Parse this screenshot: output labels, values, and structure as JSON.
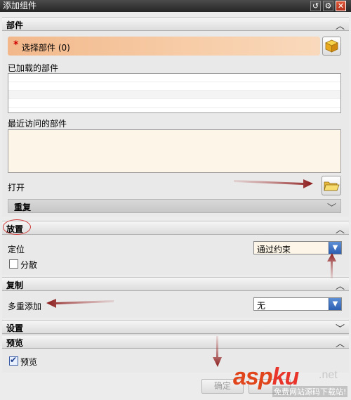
{
  "window": {
    "title": "添加组件",
    "reset_icon": "reset-icon",
    "settings_icon": "gear-icon",
    "close_icon": "close-icon"
  },
  "sections": {
    "part": {
      "header": "部件",
      "select_part": "选择部件 (0)",
      "required_mark": "*",
      "loaded_label": "已加载的部件",
      "recent_label": "最近访问的部件",
      "open_label": "打开",
      "repeat_header": "重复"
    },
    "placement": {
      "header": "放置",
      "position_label": "定位",
      "position_value": "通过约束",
      "scatter_label": "分散",
      "scatter_checked": false
    },
    "copy": {
      "header": "复制",
      "multi_add_label": "多重添加",
      "multi_add_value": "无"
    },
    "settings": {
      "header": "设置"
    },
    "preview": {
      "header": "预览",
      "preview_label": "预览",
      "preview_checked": true
    }
  },
  "footer": {
    "ok_label": "确定"
  },
  "watermark": {
    "brand_asp": "asp",
    "brand_ku": "ku",
    "brand_net": ".net",
    "tagline": "免费网站源码下载站!"
  },
  "colors": {
    "required_accent": "#d00000",
    "select_row": "#f2b88b",
    "annotation_arrow": "#8b1a1a",
    "dropdown_button": "#3b6fc4"
  }
}
